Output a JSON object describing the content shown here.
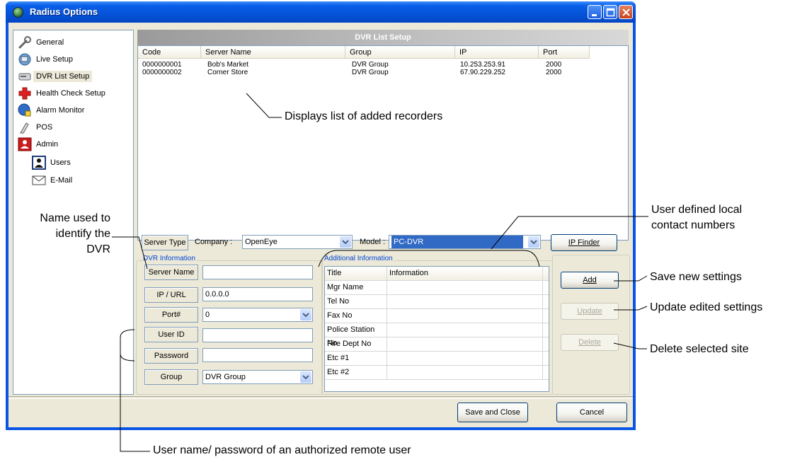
{
  "window": {
    "title": "Radius Options"
  },
  "sidebar": {
    "items": [
      {
        "label": "General",
        "icon": "wrench-icon"
      },
      {
        "label": "Live Setup",
        "icon": "live-setup-icon"
      },
      {
        "label": "DVR List Setup",
        "icon": "dvr-list-icon",
        "selected": true
      },
      {
        "label": "Health Check Setup",
        "icon": "health-cross-icon"
      },
      {
        "label": "Alarm Monitor",
        "icon": "alarm-globe-icon"
      },
      {
        "label": "POS",
        "icon": "pos-icon"
      },
      {
        "label": "Admin",
        "icon": "admin-user-icon"
      },
      {
        "label": "Users",
        "icon": "user-icon"
      },
      {
        "label": "E-Mail",
        "icon": "envelope-icon"
      }
    ]
  },
  "panel": {
    "header": "DVR List Setup"
  },
  "list": {
    "columns": [
      "Code",
      "Server Name",
      "Group",
      "IP",
      "Port"
    ],
    "rows": [
      [
        "0000000001",
        "Bob's Market",
        "DVR Group",
        "10.253.253.91",
        "2000"
      ],
      [
        "0000000002",
        "Corner Store",
        "DVR Group",
        "67.90.229.252",
        "2000"
      ]
    ]
  },
  "toolbar": {
    "server_type": "Server Type",
    "company_label": "Company :",
    "company_value": "OpenEye",
    "model_label": "Model :",
    "model_value": "PC-DVR",
    "ip_finder": "IP Finder"
  },
  "dvr_info": {
    "title": "DVR Information",
    "server_name_label": "Server Name",
    "server_name_value": "",
    "ip_label": "IP / URL",
    "ip_value": "0.0.0.0",
    "port_label": "Port#",
    "port_value": "0",
    "user_id_label": "User ID",
    "user_id_value": "",
    "password_label": "Password",
    "password_value": "",
    "group_label": "Group",
    "group_value": "DVR Group"
  },
  "additional": {
    "title": "Additional Information",
    "headers": [
      "Title",
      "Information"
    ],
    "rows": [
      "Mgr Name",
      "Tel No",
      "Fax No",
      "Police Station No",
      "Fire Dept No",
      "Etc #1",
      "Etc #2"
    ]
  },
  "buttons": {
    "add": "Add",
    "update": "Update",
    "delete": "Delete",
    "save_close": "Save and Close",
    "cancel": "Cancel"
  },
  "annotations": {
    "list": "Displays list of added recorders",
    "name_line1": "Name used to",
    "name_line2": "identify the",
    "name_line3": "DVR",
    "contact_line1": "User defined local",
    "contact_line2": "contact numbers",
    "save_new": "Save new settings",
    "update_edited": "Update edited settings",
    "delete_site": "Delete selected site",
    "remote_user": "User name/ password of an authorized remote user"
  }
}
